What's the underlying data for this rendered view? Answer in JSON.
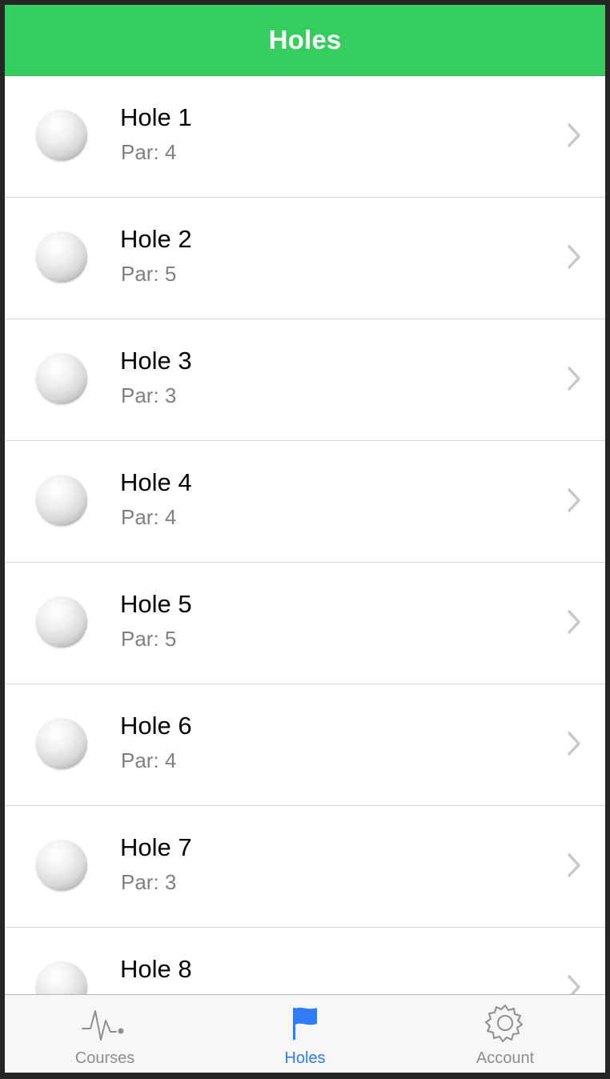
{
  "navbar": {
    "title": "Holes"
  },
  "holes": [
    {
      "name": "Hole 1",
      "par": "Par: 4"
    },
    {
      "name": "Hole 2",
      "par": "Par: 5"
    },
    {
      "name": "Hole 3",
      "par": "Par: 3"
    },
    {
      "name": "Hole 4",
      "par": "Par: 4"
    },
    {
      "name": "Hole 5",
      "par": "Par: 5"
    },
    {
      "name": "Hole 6",
      "par": "Par: 4"
    },
    {
      "name": "Hole 7",
      "par": "Par: 3"
    },
    {
      "name": "Hole 8",
      "par": ""
    }
  ],
  "tabbar": {
    "tabs": [
      {
        "label": "Courses",
        "icon": "pulse-icon",
        "active": false
      },
      {
        "label": "Holes",
        "icon": "flag-icon",
        "active": true
      },
      {
        "label": "Account",
        "icon": "gear-icon",
        "active": false
      }
    ],
    "active_color": "#2f7cf6",
    "inactive_color": "#8e8e93"
  },
  "colors": {
    "navbar": "#34cd5e",
    "separator": "#d6d6d9",
    "chevron": "#c7c7cc"
  }
}
